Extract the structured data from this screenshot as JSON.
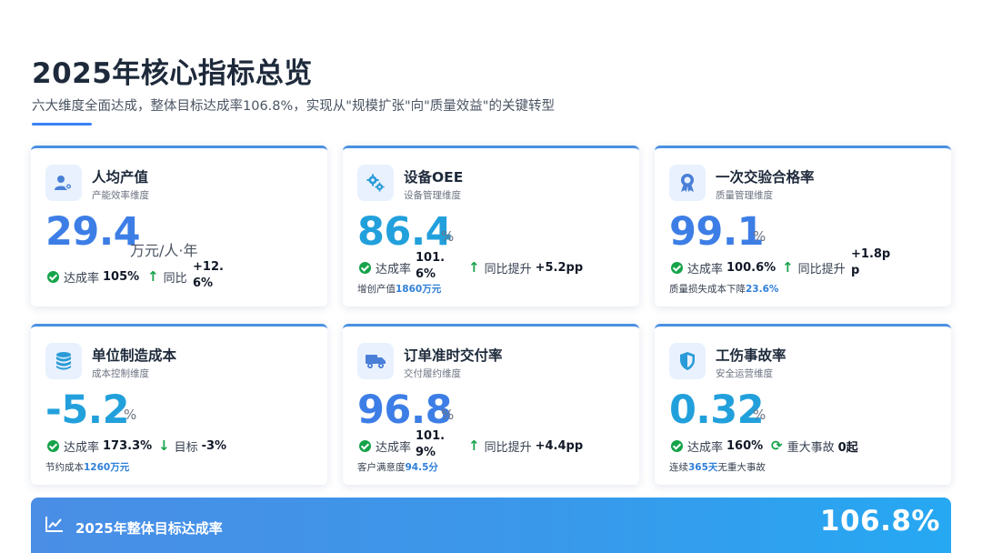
{
  "header": {
    "title": "2025年核心指标总览",
    "subtitle": "六大维度全面达成，整体目标达成率106.8%，实现从\"规模扩张\"向\"质量效益\"的关键转型"
  },
  "colors": {
    "accent_blue": "#3d7ee6",
    "accent_cyan": "#22a0dc",
    "success_green": "#16a34a",
    "title_dark": "#1e2a3b"
  },
  "cards": [
    {
      "icon": "user-gear-icon",
      "name": "人均产值",
      "sub": "产能效率维度",
      "value": "29.4",
      "unit": "万元/人·年",
      "rate_label": "达成率",
      "rate_value": "105%",
      "trend_label": "同比",
      "trend_value": "+12.6%"
    },
    {
      "icon": "gears-icon",
      "name": "设备OEE",
      "sub": "设备管理维度",
      "value": "86.4",
      "unit": "%",
      "rate_label": "达成率",
      "rate_value": "101.6%",
      "trend_label": "同比提升",
      "trend_value": "+5.2pp",
      "note_prefix": "增创产值",
      "note_value": "1860万元",
      "note_suffix": ""
    },
    {
      "icon": "award-icon",
      "name": "一次交验合格率",
      "sub": "质量管理维度",
      "value": "99.1",
      "unit": "%",
      "rate_label": "达成率",
      "rate_value": "100.6%",
      "trend_label": "同比提升",
      "trend_value": "+1.8pp",
      "note_prefix": "质量损失成本下降",
      "note_value": "23.6%",
      "note_suffix": ""
    },
    {
      "icon": "coins-icon",
      "name": "单位制造成本",
      "sub": "成本控制维度",
      "value": "-5.2",
      "unit": "%",
      "rate_label": "达成率",
      "rate_value": "173.3%",
      "trend_label": "目标",
      "trend_value": "-3%",
      "note_prefix": "节约成本",
      "note_value": "1260万元",
      "note_suffix": ""
    },
    {
      "icon": "truck-icon",
      "name": "订单准时交付率",
      "sub": "交付履约维度",
      "value": "96.8",
      "unit": "%",
      "rate_label": "达成率",
      "rate_value": "101.9%",
      "trend_label": "同比提升",
      "trend_value": "+4.4pp",
      "note_prefix": "客户满意度",
      "note_value": "94.5分",
      "note_suffix": ""
    },
    {
      "icon": "shield-icon",
      "name": "工伤事故率",
      "sub": "安全运营维度",
      "value": "0.32",
      "unit": "%",
      "rate_label": "达成率",
      "rate_value": "160%",
      "trend_label": "重大事故",
      "trend_value": "0起",
      "note_prefix": "连续",
      "note_value": "365天",
      "note_suffix": "无重大事故"
    }
  ],
  "summary": {
    "icon": "line-chart-icon",
    "label": "2025年整体目标达成率",
    "value": "106.8%"
  }
}
